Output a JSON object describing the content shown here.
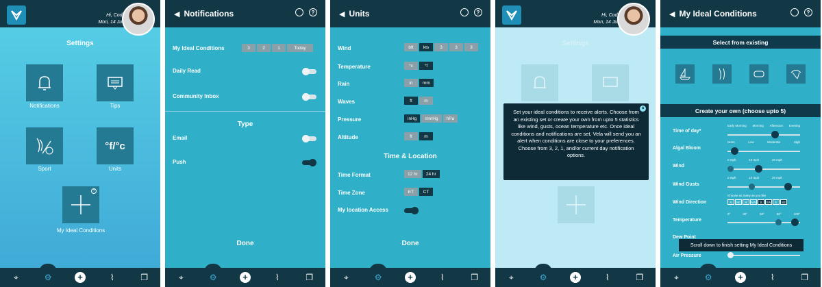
{
  "greeting": {
    "name": "Hi, Cody",
    "date": "Mon, 14 Jun"
  },
  "settings": {
    "title": "Settings",
    "tiles": [
      {
        "label": "Notifications"
      },
      {
        "label": "Tips"
      },
      {
        "label": "Sport"
      },
      {
        "label": "Units"
      },
      {
        "label": "My Ideal Conditions"
      }
    ],
    "units_glyph": "°f/°c"
  },
  "notifications": {
    "title": "Notifications",
    "ideal_label": "My Ideal Conditions",
    "ideal_options": [
      "3",
      "2",
      "1",
      "Today"
    ],
    "daily_read": "Daily Read",
    "community": "Community Inbox",
    "type_heading": "Type",
    "email": "Email",
    "push": "Push",
    "done": "Done"
  },
  "units": {
    "title": "Units",
    "rows": [
      {
        "label": "Wind",
        "options": [
          "bft",
          "kts",
          "3",
          "3",
          "3"
        ],
        "selected": 1
      },
      {
        "label": "Temperature",
        "options": [
          "°c",
          "°f"
        ],
        "selected": 1
      },
      {
        "label": "Rain",
        "options": [
          "in",
          "mm"
        ],
        "selected": 1
      },
      {
        "label": "Waves",
        "options": [
          "ft",
          "m"
        ],
        "selected": 0
      },
      {
        "label": "Pressure",
        "options": [
          "inHg",
          "mmHg",
          "hPa"
        ],
        "selected": 0
      },
      {
        "label": "Altitude",
        "options": [
          "ft",
          "m"
        ],
        "selected": 1
      }
    ],
    "time_heading": "Time & Location",
    "time_format": {
      "label": "Time Format",
      "options": [
        "12 hr",
        "24 hr"
      ],
      "selected": 1
    },
    "time_zone": {
      "label": "Time Zone",
      "options": [
        "ET",
        "CT"
      ],
      "selected": 1
    },
    "location": "My location Access",
    "done": "Done"
  },
  "tooltip": {
    "text": "Set your ideal conditions to receive alerts. Choose from an existing set or create your own from upto 5 statistics like wind, gusts, ocean temperature etc. Once ideal conditions and notifications are set, Vela will send you an alert when conditions are close to your preferences. Choose from 3, 2, 1, and/or current day notification options.",
    "close": "×",
    "faded_title": "Settings"
  },
  "ideal": {
    "title": "My Ideal Conditions",
    "select_heading": "Select from existing",
    "create_heading": "Create your own (choose upto 5)",
    "time_of_day": {
      "label": "Time of day*",
      "top": [
        "Early Morning",
        "Morning",
        "Afternoon",
        "Evening"
      ],
      "bottom": [
        "None",
        "Low",
        "Moderate",
        "High"
      ],
      "value": "Afternoon"
    },
    "algal_bloom": {
      "label": "Algal Bloom",
      "value": "None"
    },
    "wind": {
      "label": "Wind",
      "ticks": [
        "0 mph",
        "10 mph",
        "20 mph"
      ],
      "value_mph": 8
    },
    "wind_gusts": {
      "label": "Wind Gusts",
      "ticks": [
        "0 mph",
        "10 mph",
        "20 mph"
      ],
      "value_mph": [
        6,
        15
      ]
    },
    "wind_direction": {
      "label": "Wind Direction",
      "hint": "Choose as many as you like",
      "dirs": [
        "N",
        "NE",
        "W",
        "NW",
        "S",
        "SW",
        "E",
        "SE"
      ],
      "selected": [
        "S",
        "SW",
        "SE"
      ]
    },
    "temperature": {
      "label": "Temperature",
      "ticks": [
        "0°",
        "30°",
        "50°",
        "80°",
        "100°"
      ]
    },
    "partial_label": "Dew Point",
    "air_pressure": "Air Pressure",
    "toast": "Scroll down to finish setting My Ideal Conditions"
  },
  "accent": "#123745"
}
